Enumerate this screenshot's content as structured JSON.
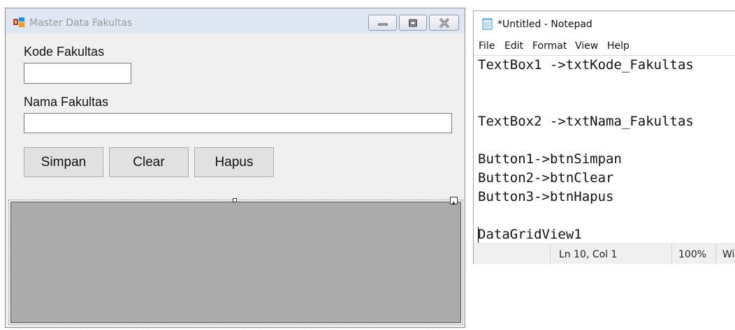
{
  "designer_form": {
    "title": "Master Data Fakultas",
    "label_kode": "Kode Fakultas",
    "label_nama": "Nama Fakultas",
    "textbox_kode_value": "",
    "textbox_nama_value": "",
    "buttons": {
      "simpan": "Simpan",
      "clear": "Clear",
      "hapus": "Hapus"
    },
    "datagrid": {
      "background": "#ababab"
    },
    "icons": {
      "app": "form-app-icon",
      "minimize": "minimize-icon",
      "maximize": "maximize-icon",
      "close": "close-icon",
      "smart_tag": "smart-tag-arrow-icon"
    }
  },
  "notepad": {
    "title": "*Untitled - Notepad",
    "menu": [
      "File",
      "Edit",
      "Format",
      "View",
      "Help"
    ],
    "lines": [
      "TextBox1 ->txtKode_Fakultas",
      "",
      "",
      "TextBox2 ->txtNama_Fakultas",
      "",
      "Button1->btnSimpan",
      "Button2->btnClear",
      "Button3->btnHapus",
      "",
      "DataGridView1"
    ],
    "status": {
      "position": "Ln 10, Col 1",
      "zoom": "100%",
      "line_ending": "Wi"
    },
    "icons": {
      "app": "notepad-icon"
    }
  }
}
